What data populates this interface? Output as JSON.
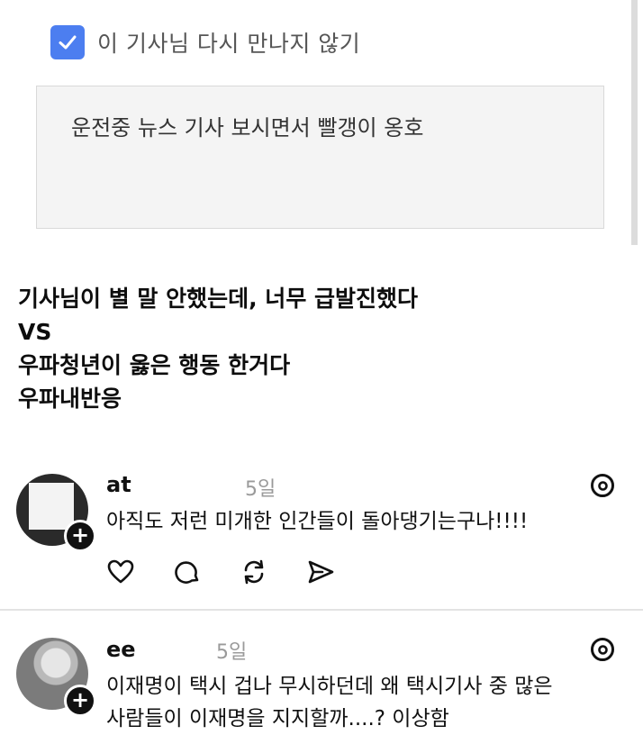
{
  "report": {
    "checkbox_label": "이 기사님 다시 만나지 않기",
    "checked": true,
    "reason_text": "운전중 뉴스 기사 보시면서 빨갱이 옹호"
  },
  "caption": {
    "lines": [
      "기사님이 별 말 안했는데, 너무 급발진했다",
      "VS",
      "우파청년이 옳은 행동 한거다",
      "우파내반응"
    ]
  },
  "posts": [
    {
      "username": "at",
      "time": "5일",
      "lines": [
        "아직도 저런 미개한 인간들이 돌아댕기는구나!!!!"
      ]
    },
    {
      "username": "ee",
      "time": "5일",
      "lines": [
        "이재명이 택시 겁나 무시하던데 왜 택시기사 중 많은",
        "사람들이 이재명을 지지할까....? 이상함"
      ]
    }
  ],
  "colors": {
    "checkbox": "#4c7ef0",
    "reason_bg": "#f4f4f4"
  },
  "icons": [
    "check-icon",
    "heart-icon",
    "comment-icon",
    "repost-icon",
    "share-icon",
    "threads-icon",
    "plus-icon"
  ]
}
